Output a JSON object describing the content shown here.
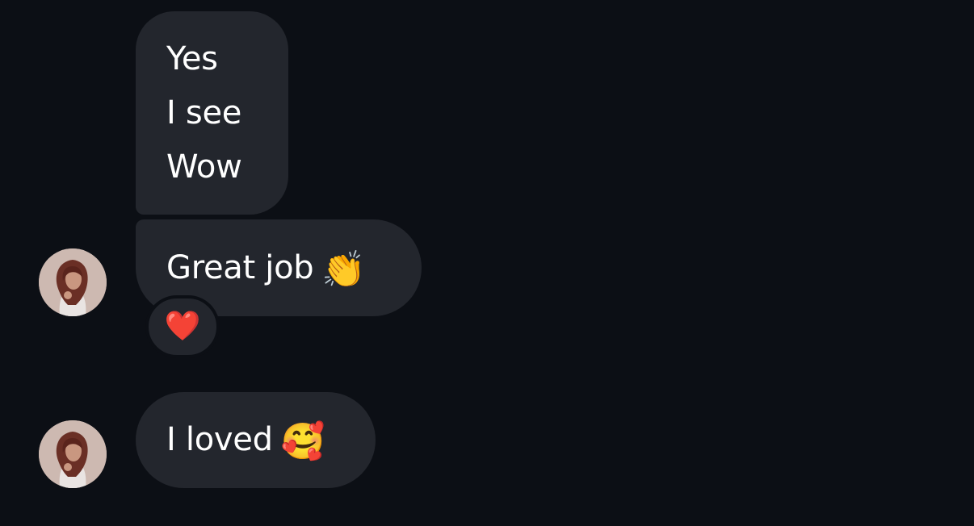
{
  "messages": [
    {
      "lines": [
        "Yes",
        "I see",
        "Wow"
      ]
    },
    {
      "text": "Great job",
      "emoji": "👏",
      "reaction": "❤️"
    },
    {
      "text": "I loved",
      "emoji": "🥰"
    }
  ],
  "icons": {
    "avatar": "profile-photo",
    "reaction": "red-heart"
  },
  "colors": {
    "background": "#0c0f15",
    "bubble": "#23262d",
    "text": "#ffffff"
  }
}
